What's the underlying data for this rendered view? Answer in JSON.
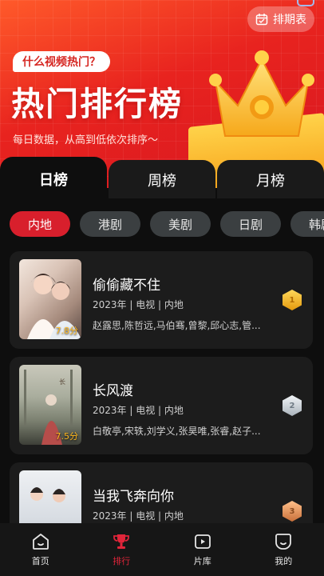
{
  "hero": {
    "schedule_label": "排期表",
    "pill_label": "什么视频热门？",
    "title": "热门排行榜",
    "subtitle": "每日数据，从高到低依次排序～"
  },
  "tabs": [
    {
      "label": "日榜",
      "active": true
    },
    {
      "label": "周榜",
      "active": false
    },
    {
      "label": "月榜",
      "active": false
    }
  ],
  "chips": [
    {
      "label": "内地",
      "active": true
    },
    {
      "label": "港剧",
      "active": false
    },
    {
      "label": "美剧",
      "active": false
    },
    {
      "label": "日剧",
      "active": false
    },
    {
      "label": "韩剧",
      "active": false
    }
  ],
  "items": [
    {
      "title": "偷偷藏不住",
      "meta": "2023年 | 电视 | 内地",
      "cast": "赵露思,陈哲远,马伯骞,曾黎,邱心志,管...",
      "score": "7.8分",
      "medal": "gold"
    },
    {
      "title": "长风渡",
      "meta": "2023年 | 电视 | 内地",
      "cast": "白敬亭,宋轶,刘学义,张昊唯,张睿,赵子...",
      "score": "7.5分",
      "medal": "silver"
    },
    {
      "title": "当我飞奔向你",
      "meta": "2023年 | 电视 | 内地",
      "cast": "",
      "score": "",
      "medal": "bronze"
    }
  ],
  "nav": [
    {
      "label": "首页",
      "icon": "home-icon",
      "active": false
    },
    {
      "label": "排行",
      "icon": "trophy-icon",
      "active": true
    },
    {
      "label": "片库",
      "icon": "video-library-icon",
      "active": false
    },
    {
      "label": "我的",
      "icon": "profile-icon",
      "active": false
    }
  ],
  "colors": {
    "accent": "#e0253a",
    "chip_active": "#d81f2c",
    "medal_gold": "#f2b320",
    "medal_silver": "#cfd6dc",
    "medal_bronze": "#e49a5c"
  }
}
